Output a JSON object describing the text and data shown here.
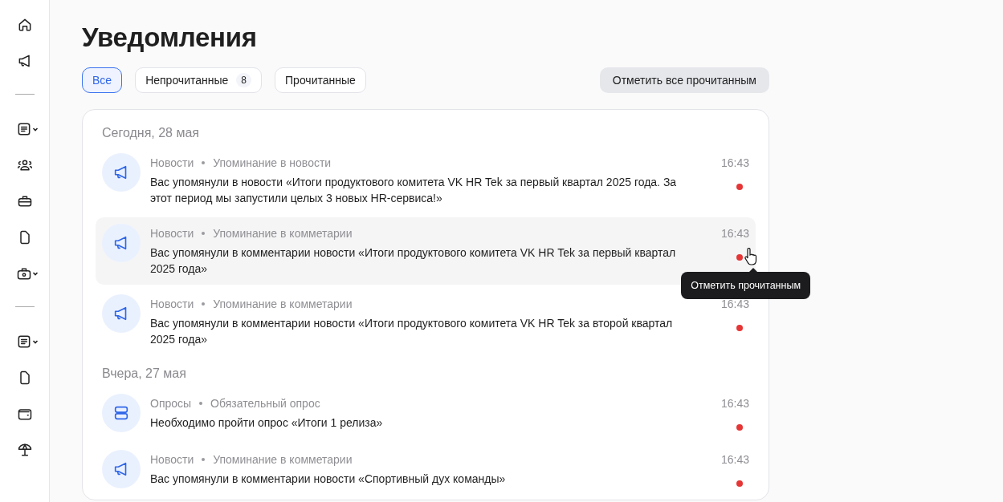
{
  "sidebar": {
    "items": [
      {
        "kind": "item",
        "expandable": false
      },
      {
        "kind": "item",
        "expandable": false
      },
      {
        "kind": "divider"
      },
      {
        "kind": "item",
        "expandable": true
      },
      {
        "kind": "item",
        "expandable": false
      },
      {
        "kind": "item",
        "expandable": false
      },
      {
        "kind": "item",
        "expandable": false
      },
      {
        "kind": "item",
        "expandable": true
      },
      {
        "kind": "divider"
      },
      {
        "kind": "item",
        "expandable": true
      },
      {
        "kind": "item",
        "expandable": false
      },
      {
        "kind": "item",
        "expandable": false
      },
      {
        "kind": "item",
        "expandable": false
      }
    ]
  },
  "title": "Уведомления",
  "filters": [
    {
      "label": "Все",
      "selected": true
    },
    {
      "label": "Непрочитанные",
      "count": "8",
      "selected": false
    },
    {
      "label": "Прочитанные",
      "selected": false
    }
  ],
  "mark_all_button": "Отметить все прочитанным",
  "groups": [
    {
      "date": "Сегодня, 28 мая",
      "items": [
        {
          "kind": "news",
          "category": "Новости",
          "type": "Упоминание в новости",
          "text": "Вас упомянули в новости «Итоги продуктового комитета VK HR Tek за первый квартал 2025 года. За этот период мы запустили целых 3 новых HR-сервиса!»",
          "time": "16:43",
          "unread": true,
          "hovered": false
        },
        {
          "kind": "news",
          "category": "Новости",
          "type": "Упоминание в комметарии",
          "text": "Вас упомянули в комментарии новости «Итоги продуктового комитета VK HR Tek за первый квартал 2025 года»",
          "time": "16:43",
          "unread": true,
          "hovered": true,
          "tooltip": "Отметить прочитанным"
        },
        {
          "kind": "news",
          "category": "Новости",
          "type": "Упоминание в комметарии",
          "text": "Вас упомянули в комментарии новости «Итоги продуктового комитета VK HR Tek за второй квартал 2025 года»",
          "time": "16:43",
          "unread": true,
          "hovered": false
        }
      ]
    },
    {
      "date": "Вчера, 27 мая",
      "items": [
        {
          "kind": "survey",
          "category": "Опросы",
          "type": "Обязательный опрос",
          "text": "Необходимо пройти опрос «Итоги 1 релиза»",
          "time": "16:43",
          "unread": true,
          "hovered": false
        },
        {
          "kind": "news",
          "category": "Новости",
          "type": "Упоминание в комметарии",
          "text": "Вас упомянули в комментарии новости «Спортивный дух команды»",
          "time": "16:43",
          "unread": true,
          "hovered": false
        }
      ]
    }
  ]
}
